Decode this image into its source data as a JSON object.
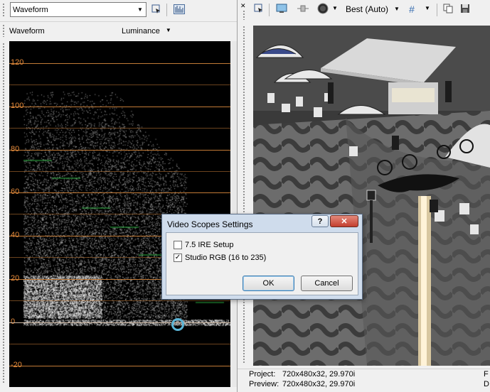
{
  "left": {
    "scope_select_value": "Waveform",
    "panel_title": "Waveform",
    "channel_dropdown": "Luminance",
    "y_axis_labels": [
      "120",
      "100",
      "80",
      "60",
      "40",
      "20",
      "0",
      "-20"
    ]
  },
  "right": {
    "quality_dropdown": "Best (Auto)",
    "project_label": "Project:",
    "project_value": "720x480x32, 29.970i",
    "preview_label": "Preview:",
    "preview_value": "720x480x32, 29.970i",
    "cut_off_1": "F",
    "cut_off_2": "D"
  },
  "dialog": {
    "title": "Video Scopes Settings",
    "help_glyph": "?",
    "close_glyph": "✕",
    "option1_label": "7.5 IRE Setup",
    "option1_checked": false,
    "option2_label": "Studio RGB (16 to 235)",
    "option2_checked": true,
    "ok_label": "OK",
    "cancel_label": "Cancel"
  },
  "colors": {
    "graticule": "#c27a36",
    "axis_label": "#e48a3a",
    "dialog_frame": "#cfdcec",
    "close_button": "#c9483a"
  }
}
